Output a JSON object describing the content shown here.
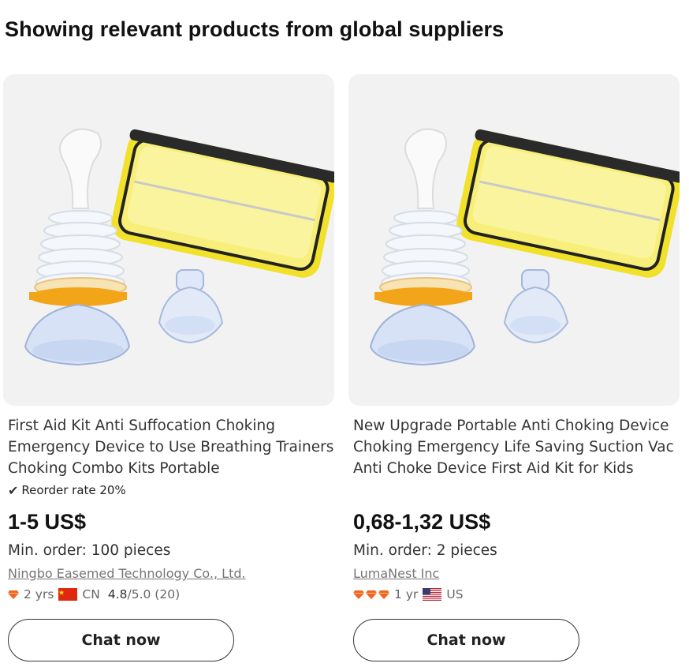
{
  "section": {
    "heading": "Showing relevant products from global suppliers"
  },
  "products": [
    {
      "title": "First Aid Kit Anti Suffocation Choking Emergency Device to Use Breathing Trainers Choking Combo Kits Portable",
      "reorder_rate": "Reorder rate 20%",
      "price": "1-5 US$",
      "min_order": "Min. order: 100 pieces",
      "supplier": "Ningbo Easemed Technology Co., Ltd.",
      "years": "2 yrs",
      "country": "CN",
      "rating": "4.8",
      "rating_suffix": "/5.0 (20)",
      "chat_label": "Chat now",
      "diamond_count": 1,
      "flag_icon": "china-flag-icon"
    },
    {
      "title": "New Upgrade Portable Anti Choking Device Choking Emergency Life Saving Suction Vac Anti Choke Device First Aid Kit for Kids",
      "price": "0,68-1,32 US$",
      "min_order": "Min. order: 2 pieces",
      "supplier": "LumaNest Inc",
      "years": "1 yr",
      "country": "US",
      "chat_label": "Chat now",
      "diamond_count": 3,
      "flag_icon": "usa-flag-icon"
    }
  ],
  "colors": {
    "diamond": "#f0661f",
    "accent_text": "#111111",
    "link": "#767676"
  }
}
